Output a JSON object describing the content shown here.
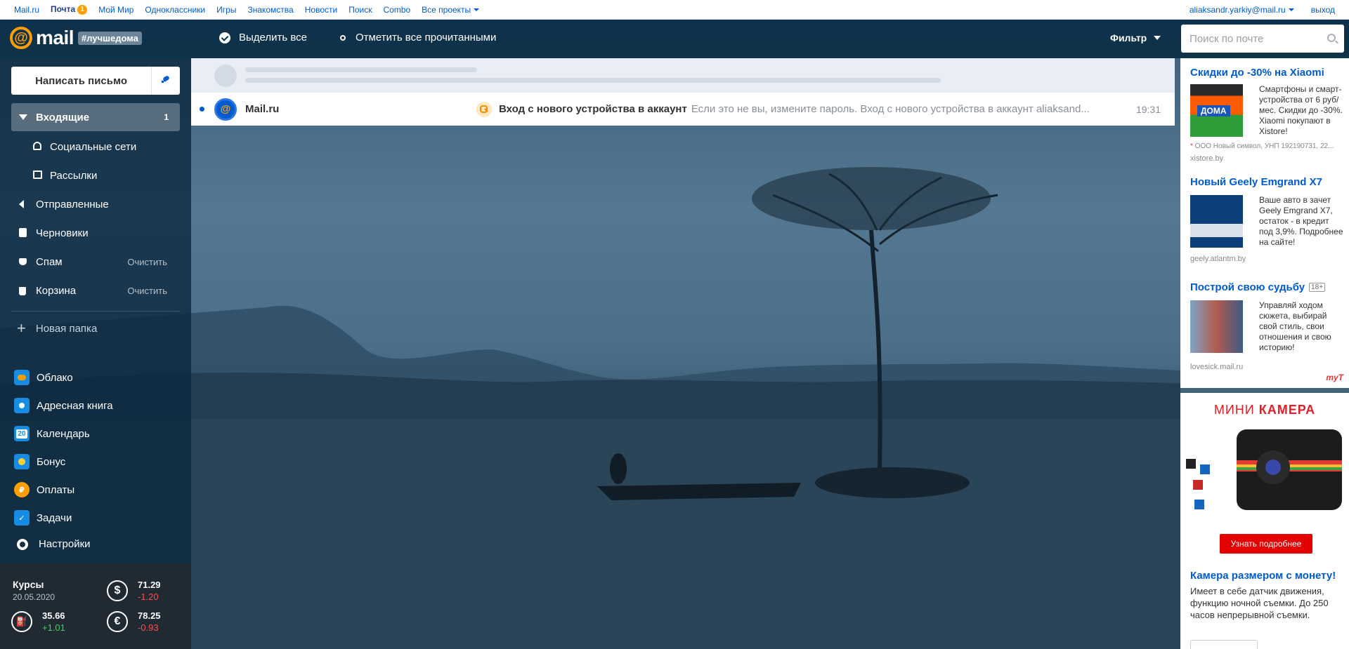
{
  "portal": {
    "links": [
      "Mail.ru",
      "Почта",
      "Мой Мир",
      "Одноклассники",
      "Игры",
      "Знакомства",
      "Новости",
      "Поиск",
      "Combo",
      "Все проекты"
    ],
    "mail_badge": "1",
    "user_email": "aliaksandr.yarkiy@mail.ru",
    "logout": "выход"
  },
  "header": {
    "logo_word": "mail",
    "logo_tag": "#лучшедома",
    "select_all": "Выделить все",
    "mark_read": "Отметить все прочитанными",
    "filter": "Фильтр",
    "search_placeholder": "Поиск по почте"
  },
  "sidebar": {
    "compose": "Написать письмо",
    "folders": {
      "inbox": {
        "label": "Входящие",
        "count": "1"
      },
      "social": {
        "label": "Социальные сети"
      },
      "newsletters": {
        "label": "Рассылки"
      },
      "sent": {
        "label": "Отправленные"
      },
      "drafts": {
        "label": "Черновики"
      },
      "spam": {
        "label": "Спам",
        "action": "Очистить"
      },
      "trash": {
        "label": "Корзина",
        "action": "Очистить"
      }
    },
    "new_folder": "Новая папка",
    "services": {
      "cloud": "Облако",
      "contacts": "Адресная книга",
      "calendar": "Календарь",
      "calendar_day": "20",
      "bonus": "Бонус",
      "payments": "Оплаты",
      "tasks": "Задачи",
      "settings": "Настройки"
    }
  },
  "courses": {
    "title": "Курсы",
    "date": "20.05.2020",
    "usd": {
      "symbol": "$",
      "value": "71.29",
      "change": "-1.20"
    },
    "eur": {
      "symbol": "€",
      "value": "78.25",
      "change": "-0.93"
    },
    "oil": {
      "value": "35.66",
      "change": "+1.01"
    }
  },
  "messages": [
    {
      "from": "Mail.ru",
      "subject": "Вход с нового устройства в аккаунт",
      "snippet": "Если это не вы, измените пароль. Вход с нового устройства в аккаунт aliaksand...",
      "time": "19:31",
      "unread": true
    }
  ],
  "ads": {
    "ad1": {
      "title": "Скидки до -30% на Xiaomi",
      "text": "Смартфоны и смарт-устройства от 6 руб/мес. Скидки до -30%. Xiaomi покупают в Xistore!",
      "legal": "ООО Новый символ, УНП 192190731, 22...",
      "source": "xistore.by",
      "img_label": "ДОМА"
    },
    "ad2": {
      "title": "Новый Geely Emgrand X7",
      "text": "Ваше авто в зачет Geely Emgrand X7, остаток - в кредит под 3,9%. Подробнее на сайте!",
      "source": "geely.atlantm.by"
    },
    "ad3": {
      "title": "Построй свою судьбу",
      "age": "18+",
      "text": "Управляй ходом сюжета, выбирай свой стиль, свои отношения и свою историю!",
      "source": "lovesick.mail.ru"
    },
    "mytarget": "myT",
    "camera": {
      "brand_light": "МИНИ ",
      "brand_bold": "КАМЕРА",
      "button": "Узнать подробнее",
      "title": "Камера размером с монету!",
      "text": "Имеет в себе датчик движения, функцию ночной съемки. До 250 часов непрерывной съемки."
    }
  },
  "colors": {
    "accent": "#005bd1",
    "logo": "#ff9e00",
    "header": "#0b2e47",
    "up": "#3bd65a",
    "down": "#ff4d4d"
  }
}
